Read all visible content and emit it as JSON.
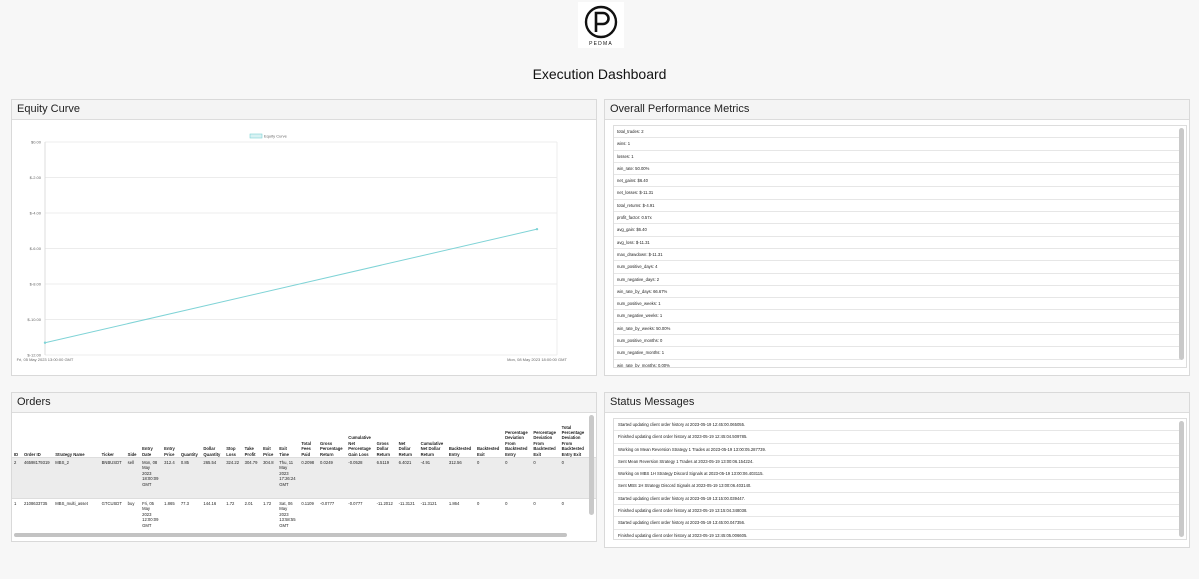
{
  "logo": {
    "text": "PEDMA",
    "icon": "pedma-logo-icon"
  },
  "page_title": "Execution Dashboard",
  "equity": {
    "title": "Equity Curve",
    "chart_data": {
      "type": "line",
      "title": "",
      "xlabel": "",
      "ylabel": "",
      "legend": "Equity Curve",
      "legend_position": "top-center",
      "x_ticks": [
        "Fri, 05 May 2023 13:00:00 GMT",
        "Mon, 08 May 2023 18:00:00 GMT"
      ],
      "y_ticks": [
        "$0.00",
        "$-2.00",
        "$-4.00",
        "$-6.00",
        "$-8.00",
        "$-10.00",
        "$-12.00"
      ],
      "ylim": [
        -12,
        0
      ],
      "grid": true,
      "series": [
        {
          "name": "Equity Curve",
          "color": "#7fd3d6",
          "points": [
            {
              "x": "Fri, 05 May 2023 13:00:00 GMT",
              "y": -11.31
            },
            {
              "x": "Mon, 08 May 2023 18:00:00 GMT",
              "y": -4.91
            }
          ]
        }
      ]
    }
  },
  "metrics": {
    "title": "Overall Performance Metrics",
    "rows": [
      "total_trades: 2",
      "wins: 1",
      "losses: 1",
      "win_rate: 50.00%",
      "net_gains: $6.40",
      "net_losses: $-11.31",
      "total_returns: $-4.91",
      "profit_factor: 0.57x",
      "avg_gain: $6.40",
      "avg_loss: $-11.31",
      "max_drawdown: $-11.31",
      "num_positive_days: 4",
      "num_negative_days: 2",
      "win_rate_by_days: 66.67%",
      "num_positive_weeks: 1",
      "num_negative_weeks: 1",
      "win_rate_by_weeks: 50.00%",
      "num_positive_months: 0",
      "num_negative_months: 1",
      "win_rate_by_months: 0.00%"
    ]
  },
  "orders": {
    "title": "Orders",
    "columns": [
      "ID",
      "Order ID",
      "Strategy Name",
      "Ticker",
      "Side",
      "Entry Date",
      "Entry Price",
      "Quantity",
      "Dollar Quantity",
      "Stop Loss",
      "Take Profit",
      "Exit Price",
      "Exit Time",
      "Total Fees Paid",
      "Gross Percentage Return",
      "Cumulative Net Percentage Gain Loss",
      "Gross Dollar Return",
      "Net Dollar Return",
      "Cumulative Net Dollar Return",
      "Backtested Entry",
      "Backtested Exit",
      "Percentage Deviation From Backtested Entry",
      "Percentage Deviation From Backtested Exit",
      "Total Percentage Deviation From Backtested Entry Exit",
      "D"
    ],
    "rows": [
      [
        "2",
        "46598179319",
        "MBS_2",
        "BNBUSDT",
        "sell",
        "Mon, 08 May 2023 18:00:09 GMT",
        "312.4",
        "0.85",
        "265.54",
        "324.22",
        "304.79",
        "304.8",
        "Thu, 11 May 2023 17:26:24 GMT",
        "0.2098",
        "0.0249",
        "-0.0528",
        "6.5119",
        "6.4021",
        "-4.91",
        "312.56",
        "0",
        "0",
        "0",
        "0",
        ""
      ],
      [
        "1",
        "2108633735",
        "MBS_multi_asset",
        "GTCUSDT",
        "buy",
        "Fri, 05 May 2023 12:00:09 GMT",
        "1.865",
        "77.3",
        "144.16",
        "1.72",
        "2.01",
        "1.72",
        "Sat, 06 May 2023 13:58:55 GMT",
        "0.1109",
        "-0.0777",
        "-0.0777",
        "-11.2012",
        "-11.3121",
        "-11.3121",
        "1.864",
        "0",
        "0",
        "0",
        "0",
        ""
      ]
    ]
  },
  "status": {
    "title": "Status Messages",
    "rows": [
      "Started updating client order history at 2023-05-19 12:45:00.065055.",
      "Finished updating client order history at 2023-05-19 12:45:04.509785.",
      "Working on Mean Reversion Strategy 1 Trades at 2023-05-19 13:00:05.287739.",
      "Sent Mean Reversion Strategy 1 Trades at 2023-05-19 13:00:06.154224.",
      "Working on MBS 1H Strategy Discord Signals at 2023-05-19 13:00:06.403115.",
      "Sent MBS 1H Strategy Discord Signals at 2023-05-19 13:00:06.403140.",
      "Started updating client order history at 2023-05-19 13:15:00.039447.",
      "Finished updating client order history at 2023-05-19 13:15:04.348038.",
      "Started updating client order history at 2023-05-19 13:45:00.047356.",
      "Finished updating client order history at 2023-05-19 13:45:05.006605."
    ]
  }
}
